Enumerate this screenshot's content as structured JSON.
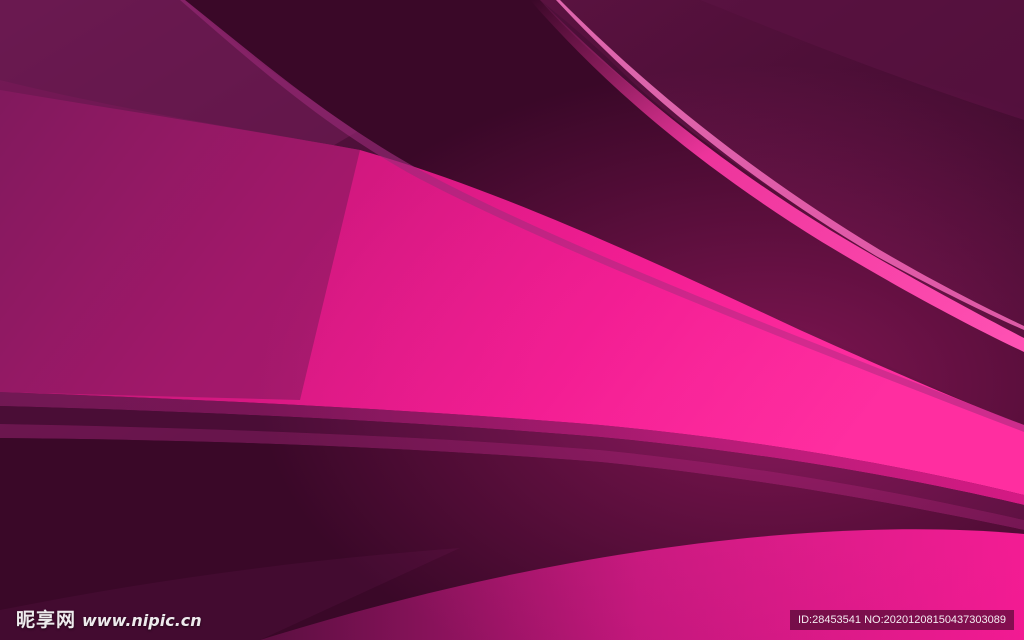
{
  "image": {
    "description_colors": {
      "dark_plum": "#3a0a2a",
      "deep_wine": "#4a0d36",
      "magenta": "#e0188a",
      "hot_pink": "#ff2ea0",
      "muted_purple": "#6a1a50"
    }
  },
  "watermark": {
    "brand": "昵享网",
    "site": "www.nipic.cn",
    "id_text": "ID:28453541 NO:20201208150437303089"
  }
}
